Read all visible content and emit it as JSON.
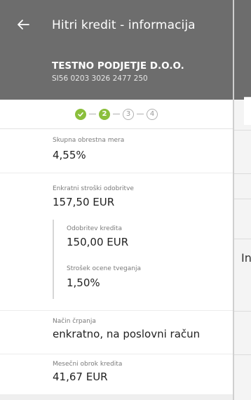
{
  "header": {
    "title": "Hitri kredit - informacija",
    "company": "TESTNO PODJETJE D.O.O.",
    "iban": "SI56 0203 3026 2477 250"
  },
  "stepper": {
    "steps": [
      {
        "label": "",
        "state": "done"
      },
      {
        "label": "2",
        "state": "active"
      },
      {
        "label": "3",
        "state": "todo"
      },
      {
        "label": "4",
        "state": "todo"
      }
    ]
  },
  "info": {
    "interest_rate_label": "Skupna obrestna mera",
    "interest_rate_value": "4,55%",
    "one_time_costs_label": "Enkratni stroški odobritve",
    "one_time_costs_value": "157,50 EUR",
    "approval_label": "Odobritev kredita",
    "approval_value": "150,00 EUR",
    "risk_label": "Strošek ocene tveganja",
    "risk_value": "1,50%",
    "drawdown_label": "Način črpanja",
    "drawdown_value": "enkratno, na poslovni račun",
    "installment_label": "Mesečni obrok kredita",
    "installment_value": "41,67 EUR"
  },
  "peek": {
    "text": "In"
  },
  "colors": {
    "header_bg": "#6d6d6d",
    "accent_green": "#8bbf3c"
  }
}
